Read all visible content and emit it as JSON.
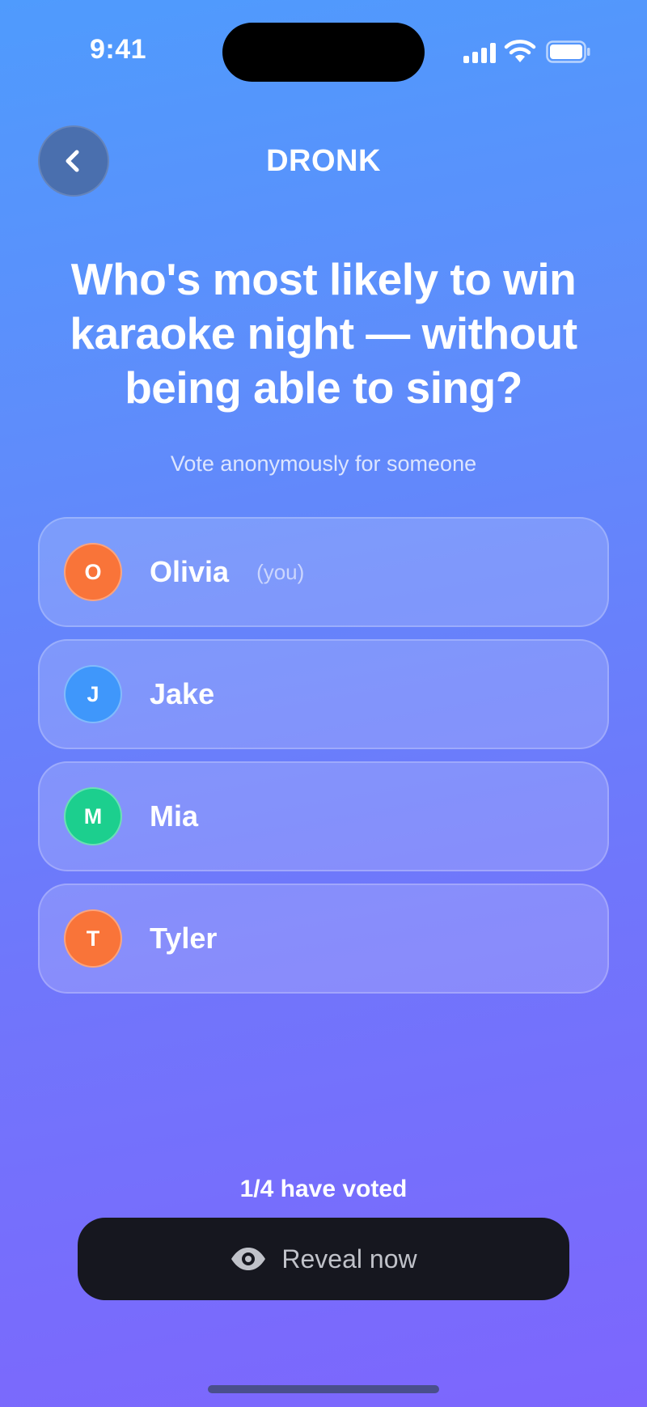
{
  "status_bar": {
    "time": "9:41"
  },
  "header": {
    "title": "DRONK",
    "back_icon": "chevron-left-icon"
  },
  "question": "Who's most likely to win karaoke night — without being able to sing?",
  "subtitle": "Vote anonymously for someone",
  "options": [
    {
      "initial": "O",
      "name": "Olivia",
      "tag": "(you)",
      "color": "#f97439"
    },
    {
      "initial": "J",
      "name": "Jake",
      "tag": "",
      "color": "#3f97fb"
    },
    {
      "initial": "M",
      "name": "Mia",
      "tag": "",
      "color": "#1ccf8e"
    },
    {
      "initial": "T",
      "name": "Tyler",
      "tag": "",
      "color": "#f97439"
    }
  ],
  "footer": {
    "vote_count": "1/4 have voted",
    "reveal_label": "Reveal now",
    "reveal_icon": "eye-icon"
  }
}
